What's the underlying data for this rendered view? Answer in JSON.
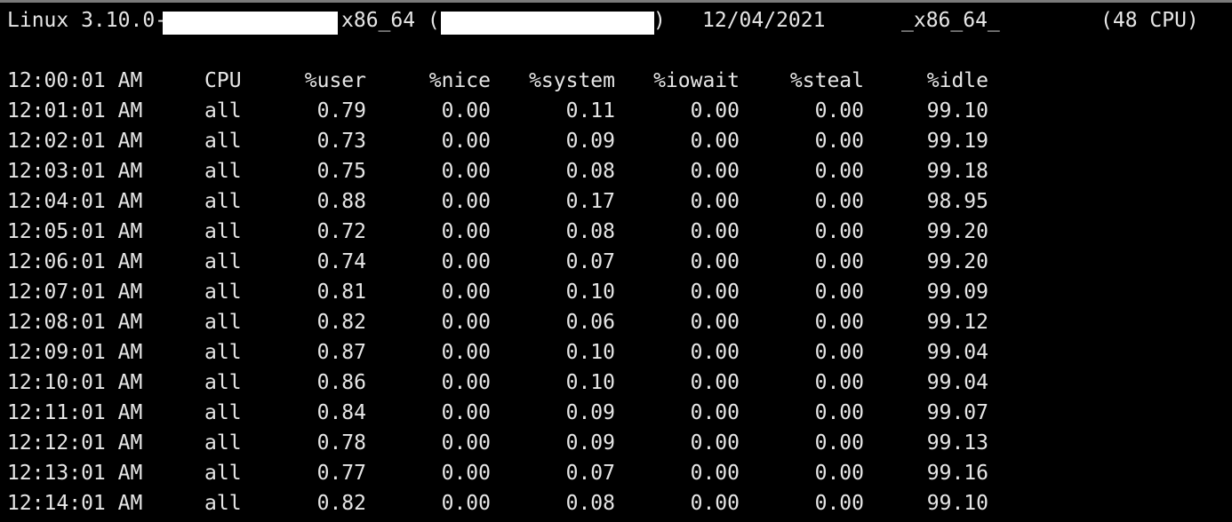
{
  "header": {
    "kernel": "Linux 3.10.0-",
    "arch_paren": "x86_64 (",
    "close_paren": ")",
    "date": "12/04/2021",
    "arch": "_x86_64_",
    "cpu_count": "(48 CPU)"
  },
  "table": {
    "columns": [
      "12:00:01 AM",
      "CPU",
      "%user",
      "%nice",
      "%system",
      "%iowait",
      "%steal",
      "%idle"
    ],
    "rows": [
      [
        "12:01:01 AM",
        "all",
        "0.79",
        "0.00",
        "0.11",
        "0.00",
        "0.00",
        "99.10"
      ],
      [
        "12:02:01 AM",
        "all",
        "0.73",
        "0.00",
        "0.09",
        "0.00",
        "0.00",
        "99.19"
      ],
      [
        "12:03:01 AM",
        "all",
        "0.75",
        "0.00",
        "0.08",
        "0.00",
        "0.00",
        "99.18"
      ],
      [
        "12:04:01 AM",
        "all",
        "0.88",
        "0.00",
        "0.17",
        "0.00",
        "0.00",
        "98.95"
      ],
      [
        "12:05:01 AM",
        "all",
        "0.72",
        "0.00",
        "0.08",
        "0.00",
        "0.00",
        "99.20"
      ],
      [
        "12:06:01 AM",
        "all",
        "0.74",
        "0.00",
        "0.07",
        "0.00",
        "0.00",
        "99.20"
      ],
      [
        "12:07:01 AM",
        "all",
        "0.81",
        "0.00",
        "0.10",
        "0.00",
        "0.00",
        "99.09"
      ],
      [
        "12:08:01 AM",
        "all",
        "0.82",
        "0.00",
        "0.06",
        "0.00",
        "0.00",
        "99.12"
      ],
      [
        "12:09:01 AM",
        "all",
        "0.87",
        "0.00",
        "0.10",
        "0.00",
        "0.00",
        "99.04"
      ],
      [
        "12:10:01 AM",
        "all",
        "0.86",
        "0.00",
        "0.10",
        "0.00",
        "0.00",
        "99.04"
      ],
      [
        "12:11:01 AM",
        "all",
        "0.84",
        "0.00",
        "0.09",
        "0.00",
        "0.00",
        "99.07"
      ],
      [
        "12:12:01 AM",
        "all",
        "0.78",
        "0.00",
        "0.09",
        "0.00",
        "0.00",
        "99.13"
      ],
      [
        "12:13:01 AM",
        "all",
        "0.77",
        "0.00",
        "0.07",
        "0.00",
        "0.00",
        "99.16"
      ],
      [
        "12:14:01 AM",
        "all",
        "0.82",
        "0.00",
        "0.08",
        "0.00",
        "0.00",
        "99.10"
      ]
    ]
  },
  "colors": {
    "background": "#000000",
    "text": "#e6e6e6",
    "redaction": "#ffffff"
  }
}
